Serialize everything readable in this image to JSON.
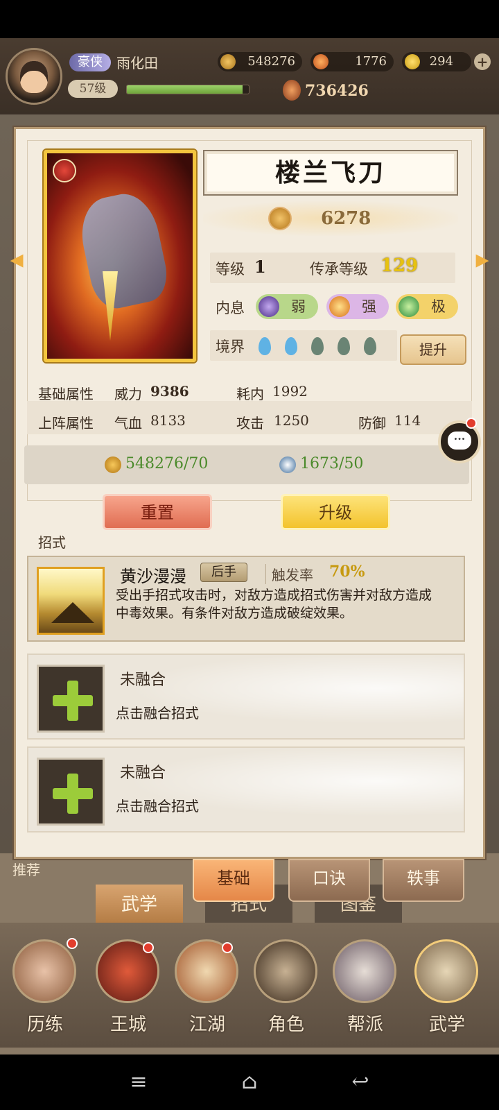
{
  "header": {
    "title_badge": "豪侠",
    "player_name": "雨化田",
    "level": "57级",
    "xp_progress": 0.95,
    "coins": "548276",
    "energy": "1776",
    "gold": "294",
    "combat_power": "736426"
  },
  "skill_card": {
    "name": "楼兰飞刀",
    "power": "6278",
    "level_label": "等级",
    "level_value": "1",
    "inherit_label": "传承等级",
    "inherit_value": "129",
    "inner_label": "内息",
    "inner_pills": [
      "弱",
      "强",
      "极"
    ],
    "realm_label": "境界",
    "upgrade_realm": "提升"
  },
  "attributes": {
    "base_label": "基础属性",
    "power_label": "威力",
    "power_value": "9386",
    "cost_label": "耗内",
    "cost_value": "1992",
    "battle_label": "上阵属性",
    "hp_label": "气血",
    "hp_value": "8133",
    "atk_label": "攻击",
    "atk_value": "1250",
    "def_label": "防御",
    "def_value": "114"
  },
  "costs": {
    "coin_cost": "548276/70",
    "item_cost": "1673/50"
  },
  "buttons": {
    "reset": "重置",
    "upgrade": "升级"
  },
  "moves": {
    "section_title": "招式",
    "skill": {
      "name": "黄沙漫漫",
      "tag": "后手",
      "trigger_label": "触发率",
      "trigger_value": "70%",
      "desc": "受出手招式攻击时，对敌方造成招式伤害并对敌方造成中毒效果。有条件对敌方造成破绽效果。"
    },
    "slots": [
      {
        "title": "未融合",
        "hint": "点击融合招式"
      },
      {
        "title": "未融合",
        "hint": "点击融合招式"
      }
    ]
  },
  "subtabs": [
    "基础",
    "口诀",
    "轶事"
  ],
  "lowtabs": [
    "武学",
    "招式",
    "图鉴"
  ],
  "recommend": "推荐",
  "bottom_nav": [
    "历练",
    "王城",
    "江湖",
    "角色",
    "帮派",
    "武学"
  ]
}
